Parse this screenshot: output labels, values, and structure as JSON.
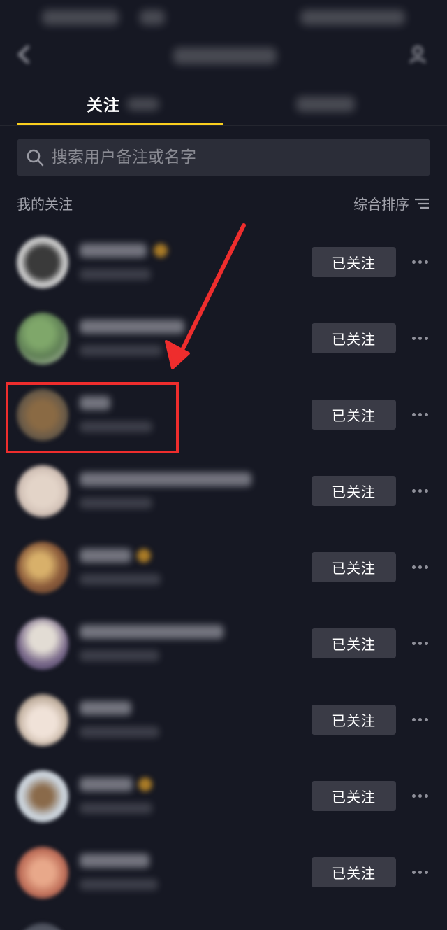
{
  "tabs": [
    {
      "label": "关注",
      "active": true
    },
    {
      "label": "",
      "active": false
    }
  ],
  "search": {
    "placeholder": "搜索用户备注或名字"
  },
  "section": {
    "title": "我的关注",
    "sort_label": "综合排序"
  },
  "follow_button_label": "已关注",
  "icons": {
    "search": "search-icon",
    "sort": "sort-icon",
    "more": "more-icon",
    "back": "back-icon",
    "add_friend": "add-friend-icon"
  },
  "colors": {
    "background": "#161823",
    "tab_indicator": "#facf1e",
    "button_bg": "#3a3b46",
    "annotation": "#ee2d2d"
  },
  "list": [
    {
      "follow_label": "已关注",
      "verified": true
    },
    {
      "follow_label": "已关注",
      "verified": false
    },
    {
      "follow_label": "已关注",
      "verified": false
    },
    {
      "follow_label": "已关注",
      "verified": false
    },
    {
      "follow_label": "已关注",
      "verified": true
    },
    {
      "follow_label": "已关注",
      "verified": false
    },
    {
      "follow_label": "已关注",
      "verified": false
    },
    {
      "follow_label": "已关注",
      "verified": true
    },
    {
      "follow_label": "已关注",
      "verified": false
    }
  ]
}
